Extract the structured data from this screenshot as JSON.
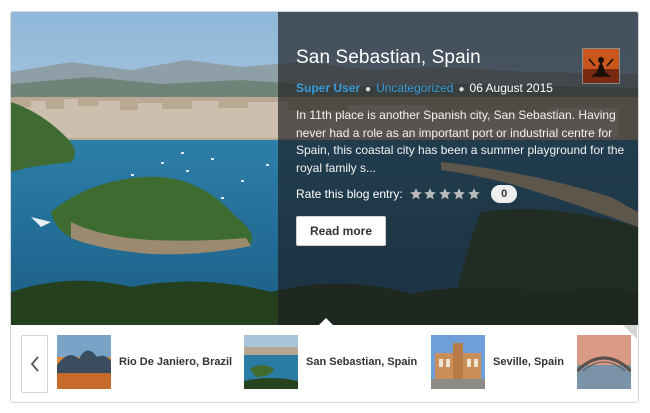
{
  "post": {
    "title": "San Sebastian, Spain",
    "author": "Super User",
    "category": "Uncategorized",
    "date": "06 August 2015",
    "excerpt": "In 11th place is another Spanish city, San Sebastian. Having never had a role as an important port or industrial centre for Spain, this coastal city has been a summer playground for the royal family s...",
    "rate_label": "Rate this blog entry:",
    "rating_stars": 5,
    "rating_value": 0,
    "vote_count": "0",
    "read_more": "Read more"
  },
  "carousel": {
    "items": [
      {
        "label": "Rio De Janiero, Brazil",
        "icon": "rio-thumbnail"
      },
      {
        "label": "San Sebastian, Spain",
        "icon": "san-sebastian-thumbnail"
      },
      {
        "label": "Seville, Spain",
        "icon": "seville-thumbnail"
      },
      {
        "label": "",
        "icon": "sydney-thumbnail"
      }
    ],
    "prev_icon": "chevron-left-icon"
  },
  "colors": {
    "link": "#3a9ad9",
    "overlay": "#1c1c1e",
    "text_dark": "#333333"
  }
}
